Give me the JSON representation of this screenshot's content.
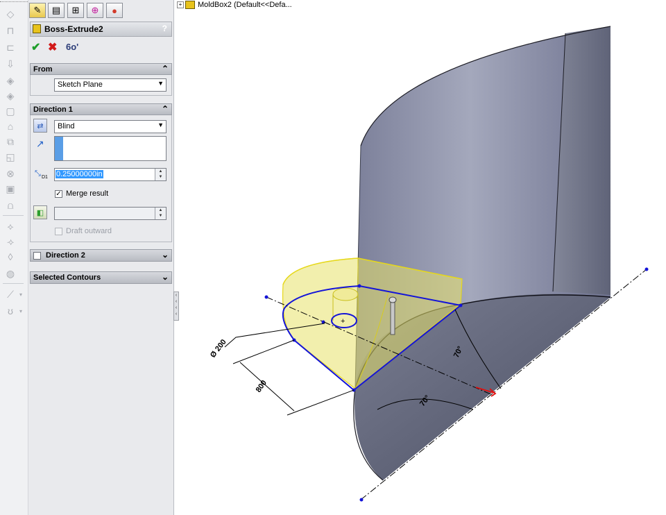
{
  "feature_tree": {
    "expand": "+",
    "label": "MoldBox2  (Default<<Defa..."
  },
  "property_manager": {
    "title": "Boss-Extrude2",
    "help": "?",
    "ok_glyph": "✔",
    "cancel_glyph": "✖",
    "preview_glyph": "6o'",
    "from": {
      "header": "From",
      "collapse_glyph": "⌃",
      "start_condition": "Sketch Plane"
    },
    "direction1": {
      "header": "Direction 1",
      "collapse_glyph": "⌃",
      "end_condition": "Blind",
      "depth_value": "0.25000000in",
      "depth_label": "D1",
      "merge_result_label": "Merge result",
      "merge_result_checked": true,
      "draft_outward_label": "Draft outward",
      "draft_outward_checked": false
    },
    "direction2": {
      "header": "Direction 2",
      "expand_glyph": "⌄",
      "checked": false
    },
    "selected_contours": {
      "header": "Selected Contours",
      "expand_glyph": "⌄"
    }
  },
  "viewport": {
    "dimensions": {
      "diameter": "Ø 200",
      "length": "800",
      "angle1": "70°",
      "angle2": "70°"
    },
    "colors": {
      "body": "#8e92a8",
      "sketch": "#1414d8",
      "preview": "#e8e26a",
      "accent_red": "#e01010"
    }
  }
}
